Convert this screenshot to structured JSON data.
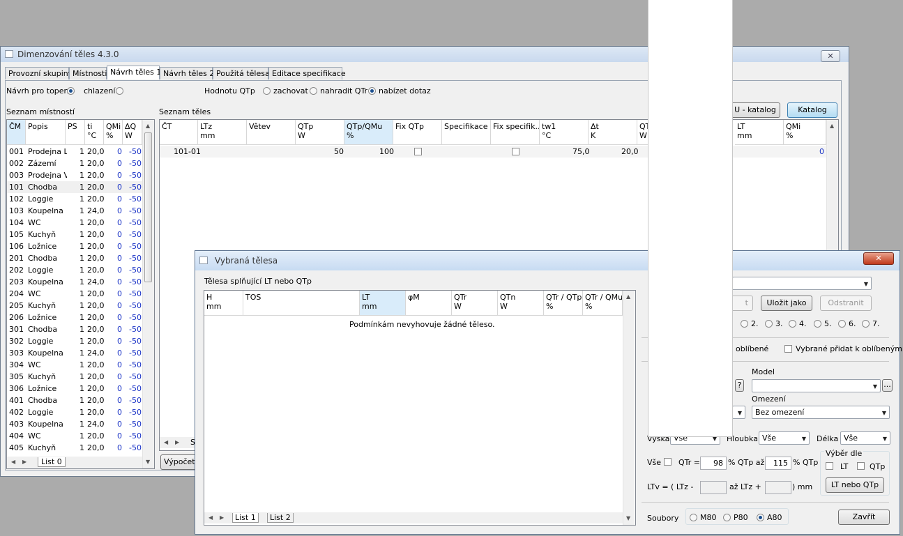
{
  "main_window": {
    "title": "Dimenzování těles 4.3.0",
    "close_glyph": "✕",
    "tabs": [
      "Provozní skupiny",
      "Místnosti",
      "Návrh těles 1",
      "Návrh těles 2",
      "Použitá tělesa",
      "Editace specifikace"
    ],
    "design_for_label": "Návrh pro topení",
    "cooling_label": "chlazení",
    "qtp_value_label": "Hodnotu QTp",
    "qtp_options": [
      "zachovat",
      "nahradit QTr",
      "nabízet dotaz"
    ],
    "u_katalog_button": "U - katalog",
    "katalog_button": "Katalog",
    "rooms_title": "Seznam místností",
    "rooms_headers": [
      [
        "ČM",
        ""
      ],
      [
        "Popis",
        ""
      ],
      [
        "PS",
        ""
      ],
      [
        "ti",
        "°C"
      ],
      [
        "QMi",
        "%"
      ],
      [
        "ΔQ",
        "W"
      ]
    ],
    "rooms": [
      [
        "001",
        "Prodejna Ll",
        "1",
        "20,0",
        "0",
        "-50"
      ],
      [
        "002",
        "Zázemí",
        "1",
        "20,0",
        "0",
        "-50"
      ],
      [
        "003",
        "Prodejna Vi",
        "1",
        "20,0",
        "0",
        "-50"
      ],
      [
        "101",
        "Chodba",
        "1",
        "20,0",
        "0",
        "-50"
      ],
      [
        "102",
        "Loggie",
        "1",
        "20,0",
        "0",
        "-50"
      ],
      [
        "103",
        "Koupelna",
        "1",
        "24,0",
        "0",
        "-50"
      ],
      [
        "104",
        "WC",
        "1",
        "20,0",
        "0",
        "-50"
      ],
      [
        "105",
        "Kuchyň",
        "1",
        "20,0",
        "0",
        "-50"
      ],
      [
        "106",
        "Ložnice",
        "1",
        "20,0",
        "0",
        "-50"
      ],
      [
        "201",
        "Chodba",
        "1",
        "20,0",
        "0",
        "-50"
      ],
      [
        "202",
        "Loggie",
        "1",
        "20,0",
        "0",
        "-50"
      ],
      [
        "203",
        "Koupelna",
        "1",
        "24,0",
        "0",
        "-50"
      ],
      [
        "204",
        "WC",
        "1",
        "20,0",
        "0",
        "-50"
      ],
      [
        "205",
        "Kuchyň",
        "1",
        "20,0",
        "0",
        "-50"
      ],
      [
        "206",
        "Ložnice",
        "1",
        "20,0",
        "0",
        "-50"
      ],
      [
        "301",
        "Chodba",
        "1",
        "20,0",
        "0",
        "-50"
      ],
      [
        "302",
        "Loggie",
        "1",
        "20,0",
        "0",
        "-50"
      ],
      [
        "303",
        "Koupelna",
        "1",
        "24,0",
        "0",
        "-50"
      ],
      [
        "304",
        "WC",
        "1",
        "20,0",
        "0",
        "-50"
      ],
      [
        "305",
        "Kuchyň",
        "1",
        "20,0",
        "0",
        "-50"
      ],
      [
        "306",
        "Ložnice",
        "1",
        "20,0",
        "0",
        "-50"
      ],
      [
        "401",
        "Chodba",
        "1",
        "20,0",
        "0",
        "-50"
      ],
      [
        "402",
        "Loggie",
        "1",
        "20,0",
        "0",
        "-50"
      ],
      [
        "403",
        "Koupelna",
        "1",
        "24,0",
        "0",
        "-50"
      ],
      [
        "404",
        "WC",
        "1",
        "20,0",
        "0",
        "-50"
      ],
      [
        "405",
        "Kuchyň",
        "1",
        "20,0",
        "0",
        "-50"
      ]
    ],
    "rooms_sheet_tab": "List 0",
    "bodies_title": "Seznam těles",
    "bodies_headers": [
      [
        "ČT",
        ""
      ],
      [
        "LTz",
        "mm"
      ],
      [
        "Větev",
        ""
      ],
      [
        "QTp",
        "W"
      ],
      [
        "QTp/QMu",
        "%"
      ],
      [
        "Fix QTp",
        ""
      ],
      [
        "Specifikace",
        ""
      ],
      [
        "Fix specifik...",
        ""
      ],
      [
        "tw1",
        "°C"
      ],
      [
        "Δt",
        "K"
      ],
      [
        "QT",
        "W"
      ],
      [
        "LT",
        "mm"
      ],
      [
        "QMi",
        "%"
      ]
    ],
    "body_row": {
      "ct": "101-01",
      "qtp": "50",
      "ratio": "100",
      "tw1": "75,0",
      "dt": "20,0",
      "qmi": "0"
    },
    "bodies_sheet_tab_partial": "S",
    "calc_button_partial": "Výpočet Q"
  },
  "dialog": {
    "title": "Vybraná tělesa",
    "close_glyph": "✕",
    "subtitle": "Tělesa splňující LT nebo QTp",
    "headers": [
      [
        "H",
        "mm"
      ],
      [
        "TOS",
        ""
      ],
      [
        "LT",
        "mm"
      ],
      [
        "φM",
        ""
      ],
      [
        "QTr",
        "W"
      ],
      [
        "QTn",
        "W"
      ],
      [
        "QTr / QTp",
        "%"
      ],
      [
        "QTr / QMu",
        "%"
      ]
    ],
    "empty_message": "Podmínkám nevyhovuje žádné těleso.",
    "sheet_tabs": [
      "List 1",
      "List 2"
    ],
    "save_as_button": "Uložit jako",
    "remove_button": "Odstranit",
    "partial_button_t": "t",
    "numbered_options": [
      "2.",
      "3.",
      "4.",
      "5.",
      "6.",
      "7."
    ],
    "favorites_label": "oblíbené",
    "add_favorites_label": "Vybrané přidat k oblíbeným",
    "model_label": "Model",
    "question_button": "?",
    "ellipsis_button": "...",
    "omezeni_label": "Omezení",
    "omezeni_value": "Bez omezení",
    "vyska_label": "Výška",
    "vyska_value": "Vše",
    "hloubka_label": "Hloubka",
    "hloubka_value": "Vše",
    "delka_label": "Délka",
    "delka_value": "Vše",
    "vse_label": "Vše",
    "qtr_eq": "QTr =",
    "qtr_from": "98",
    "qtp_to_label": "% QTp až",
    "qtr_to": "115",
    "qtp_pct": "% QTp",
    "vyber_dle_label": "Výběr dle",
    "lt_label": "LT",
    "qtp_label": "QTp",
    "ltv_label": "LTv  =  ( LTz  -",
    "az_label": "až  LTz  +",
    "mm_label": ") mm",
    "lt_or_qtp_button": "LT nebo QTp",
    "soubory_label": "Soubory",
    "files_options": [
      "M80",
      "P80",
      "A80"
    ],
    "close_button": "Zavřít"
  }
}
